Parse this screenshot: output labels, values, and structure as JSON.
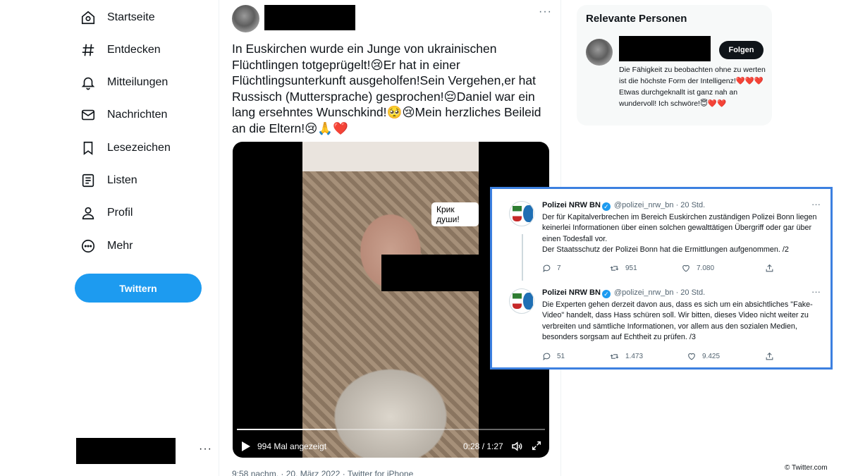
{
  "sidebar": {
    "items": [
      {
        "label": "Startseite",
        "icon": "home-icon"
      },
      {
        "label": "Entdecken",
        "icon": "hashtag-icon"
      },
      {
        "label": "Mitteilungen",
        "icon": "bell-icon"
      },
      {
        "label": "Nachrichten",
        "icon": "mail-icon"
      },
      {
        "label": "Lesezeichen",
        "icon": "bookmark-icon"
      },
      {
        "label": "Listen",
        "icon": "list-icon"
      },
      {
        "label": "Profil",
        "icon": "person-icon"
      },
      {
        "label": "Mehr",
        "icon": "more-circle-icon"
      }
    ],
    "tweet_button": "Twittern",
    "account_more": "···"
  },
  "tweet": {
    "more": "···",
    "text": "In Euskirchen wurde ein Junge von ukrainischen Flüchtlingen totgeprügelt!😢Er hat in einer Flüchtlingsunterkunft ausgeholfen!Sein Vergehen,er hat Russisch (Muttersprache) gesprochen!😔Daniel war ein lang ersehntes Wunschkind!🥺😢Mein herzliches Beileid an die Eltern!😢🙏❤️",
    "video": {
      "caption": "Крик души!",
      "views": "994 Mal angezeigt",
      "time": "0:28 / 1:27",
      "progress": 0.32
    },
    "meta": "9:58 nachm. · 20. März 2022 · Twitter for iPhone"
  },
  "relevant": {
    "title": "Relevante Personen",
    "follow": "Folgen",
    "bio": "Die Fähigkeit zu beobachten ohne zu werten ist die höchste Form der Intelligenz!❤️❤️❤️ Etwas durchgeknallt ist ganz nah an wundervoll! Ich schwöre!😇❤️❤️"
  },
  "police_tweets": [
    {
      "name": "Polizei NRW BN",
      "handle": "@polizei_nrw_bn · 20 Std.",
      "text": "Der für Kapitalverbrechen im Bereich Euskirchen zuständigen Polizei Bonn liegen keinerlei Informationen über einen solchen gewalttätigen Übergriff oder gar über einen Todesfall vor.\nDer Staatsschutz der Polizei Bonn hat die Ermittlungen aufgenommen. /2",
      "replies": "7",
      "retweets": "951",
      "likes": "7.080"
    },
    {
      "name": "Polizei NRW BN",
      "handle": "@polizei_nrw_bn · 20 Std.",
      "text": "Die Experten gehen derzeit davon aus, dass es sich um ein absichtliches \"Fake-Video\" handelt, dass Hass schüren soll. Wir bitten, dieses Video nicht weiter zu verbreiten und sämtliche Informationen, vor allem aus den sozialen Medien, besonders sorgsam auf Echtheit zu prüfen. /3",
      "replies": "51",
      "retweets": "1.473",
      "likes": "9.425"
    }
  ],
  "credit": "© Twitter.com",
  "colors": {
    "accent": "#1d9bf0",
    "overlay_border": "#3c80e0"
  }
}
